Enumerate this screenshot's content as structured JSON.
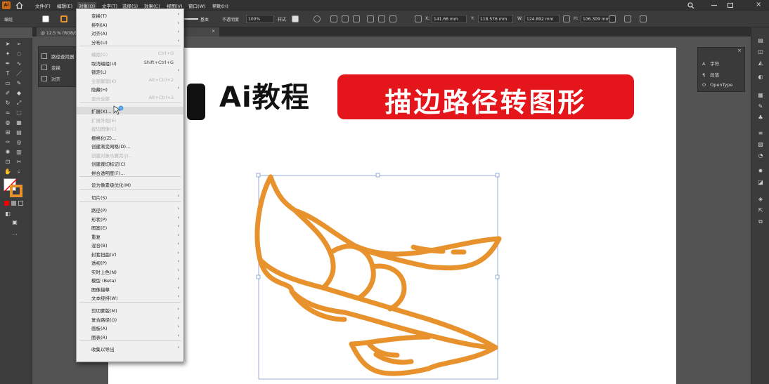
{
  "menubar": {
    "items": [
      "文件(F)",
      "编辑(E)",
      "对象(O)",
      "文字(T)",
      "选择(S)",
      "效果(C)",
      "视图(V)",
      "窗口(W)",
      "帮助(H)"
    ]
  },
  "control_bar": {
    "selection_label": "编组",
    "stroke_style": "基本",
    "opacity_label": "不透明度",
    "opacity_value": "100%",
    "style_label": "样式",
    "x_value": "141.66 mm",
    "y_value": "118.576 mm",
    "w_value": "124.892 mm",
    "h_value": "106.309 mm"
  },
  "document_tab": {
    "title": "@ 12.5 % (RGB/GPU 预览)",
    "close": "×"
  },
  "left_panel": {
    "items": [
      "路径查找器",
      "变换",
      "对齐"
    ]
  },
  "right_panel": {
    "items": [
      "字符",
      "段落",
      "OpenType"
    ],
    "close": "×"
  },
  "object_menu": {
    "items": [
      {
        "label": "变换(T)",
        "shortcut": "",
        "submenu": true,
        "disabled": false
      },
      {
        "label": "排列(A)",
        "shortcut": "",
        "submenu": true,
        "disabled": false
      },
      {
        "label": "对齐(A)",
        "shortcut": "",
        "submenu": true,
        "disabled": false
      },
      {
        "label": "分布(U)",
        "shortcut": "",
        "submenu": true,
        "disabled": false
      },
      {
        "label": "编组(G)",
        "shortcut": "Ctrl+G",
        "submenu": false,
        "disabled": true
      },
      {
        "label": "取消编组(U)",
        "shortcut": "Shift+Ctrl+G",
        "submenu": false,
        "disabled": false
      },
      {
        "label": "锁定(L)",
        "shortcut": "",
        "submenu": true,
        "disabled": false
      },
      {
        "label": "全部解锁(K)",
        "shortcut": "Alt+Ctrl+2",
        "submenu": false,
        "disabled": true
      },
      {
        "label": "隐藏(H)",
        "shortcut": "",
        "submenu": true,
        "disabled": false
      },
      {
        "label": "显示全部",
        "shortcut": "Alt+Ctrl+3",
        "submenu": false,
        "disabled": true
      },
      {
        "label": "扩展(X)...",
        "shortcut": "",
        "submenu": false,
        "disabled": false
      },
      {
        "label": "扩展外观(E)",
        "shortcut": "",
        "submenu": false,
        "disabled": true
      },
      {
        "label": "裁切图像(C)",
        "shortcut": "",
        "submenu": false,
        "disabled": true
      },
      {
        "label": "栅格化(Z)...",
        "shortcut": "",
        "submenu": false,
        "disabled": false
      },
      {
        "label": "创建渐变网格(D)...",
        "shortcut": "",
        "submenu": false,
        "disabled": false
      },
      {
        "label": "创建对象马赛克(J)...",
        "shortcut": "",
        "submenu": false,
        "disabled": true
      },
      {
        "label": "创建裁切标记(C)",
        "shortcut": "",
        "submenu": false,
        "disabled": false
      },
      {
        "label": "拼合透明度(F)...",
        "shortcut": "",
        "submenu": false,
        "disabled": false
      },
      {
        "label": "设为像素级优化(M)",
        "shortcut": "",
        "submenu": false,
        "disabled": false
      },
      {
        "label": "切片(S)",
        "shortcut": "",
        "submenu": true,
        "disabled": false
      },
      {
        "label": "路径(P)",
        "shortcut": "",
        "submenu": true,
        "disabled": false
      },
      {
        "label": "形状(P)",
        "shortcut": "",
        "submenu": true,
        "disabled": false
      },
      {
        "label": "图案(E)",
        "shortcut": "",
        "submenu": true,
        "disabled": false
      },
      {
        "label": "重复",
        "shortcut": "",
        "submenu": true,
        "disabled": false
      },
      {
        "label": "混合(B)",
        "shortcut": "",
        "submenu": true,
        "disabled": false
      },
      {
        "label": "封套扭曲(V)",
        "shortcut": "",
        "submenu": true,
        "disabled": false
      },
      {
        "label": "透视(P)",
        "shortcut": "",
        "submenu": true,
        "disabled": false
      },
      {
        "label": "实时上色(N)",
        "shortcut": "",
        "submenu": true,
        "disabled": false
      },
      {
        "label": "模型 (Beta)",
        "shortcut": "",
        "submenu": true,
        "disabled": false
      },
      {
        "label": "图像描摹",
        "shortcut": "",
        "submenu": true,
        "disabled": false
      },
      {
        "label": "文本绕排(W)",
        "shortcut": "",
        "submenu": true,
        "disabled": false
      },
      {
        "label": "剪切蒙版(M)",
        "shortcut": "",
        "submenu": true,
        "disabled": false
      },
      {
        "label": "复合路径(O)",
        "shortcut": "",
        "submenu": true,
        "disabled": false
      },
      {
        "label": "画板(A)",
        "shortcut": "",
        "submenu": true,
        "disabled": false
      },
      {
        "label": "图表(R)",
        "shortcut": "",
        "submenu": true,
        "disabled": false
      },
      {
        "label": "收集以导出",
        "shortcut": "",
        "submenu": true,
        "disabled": false
      }
    ]
  },
  "artwork": {
    "title_left": "Ai教程",
    "banner_text": "描边路径转图形",
    "banner_color": "#e4151b",
    "stroke_color": "#e8922e"
  }
}
